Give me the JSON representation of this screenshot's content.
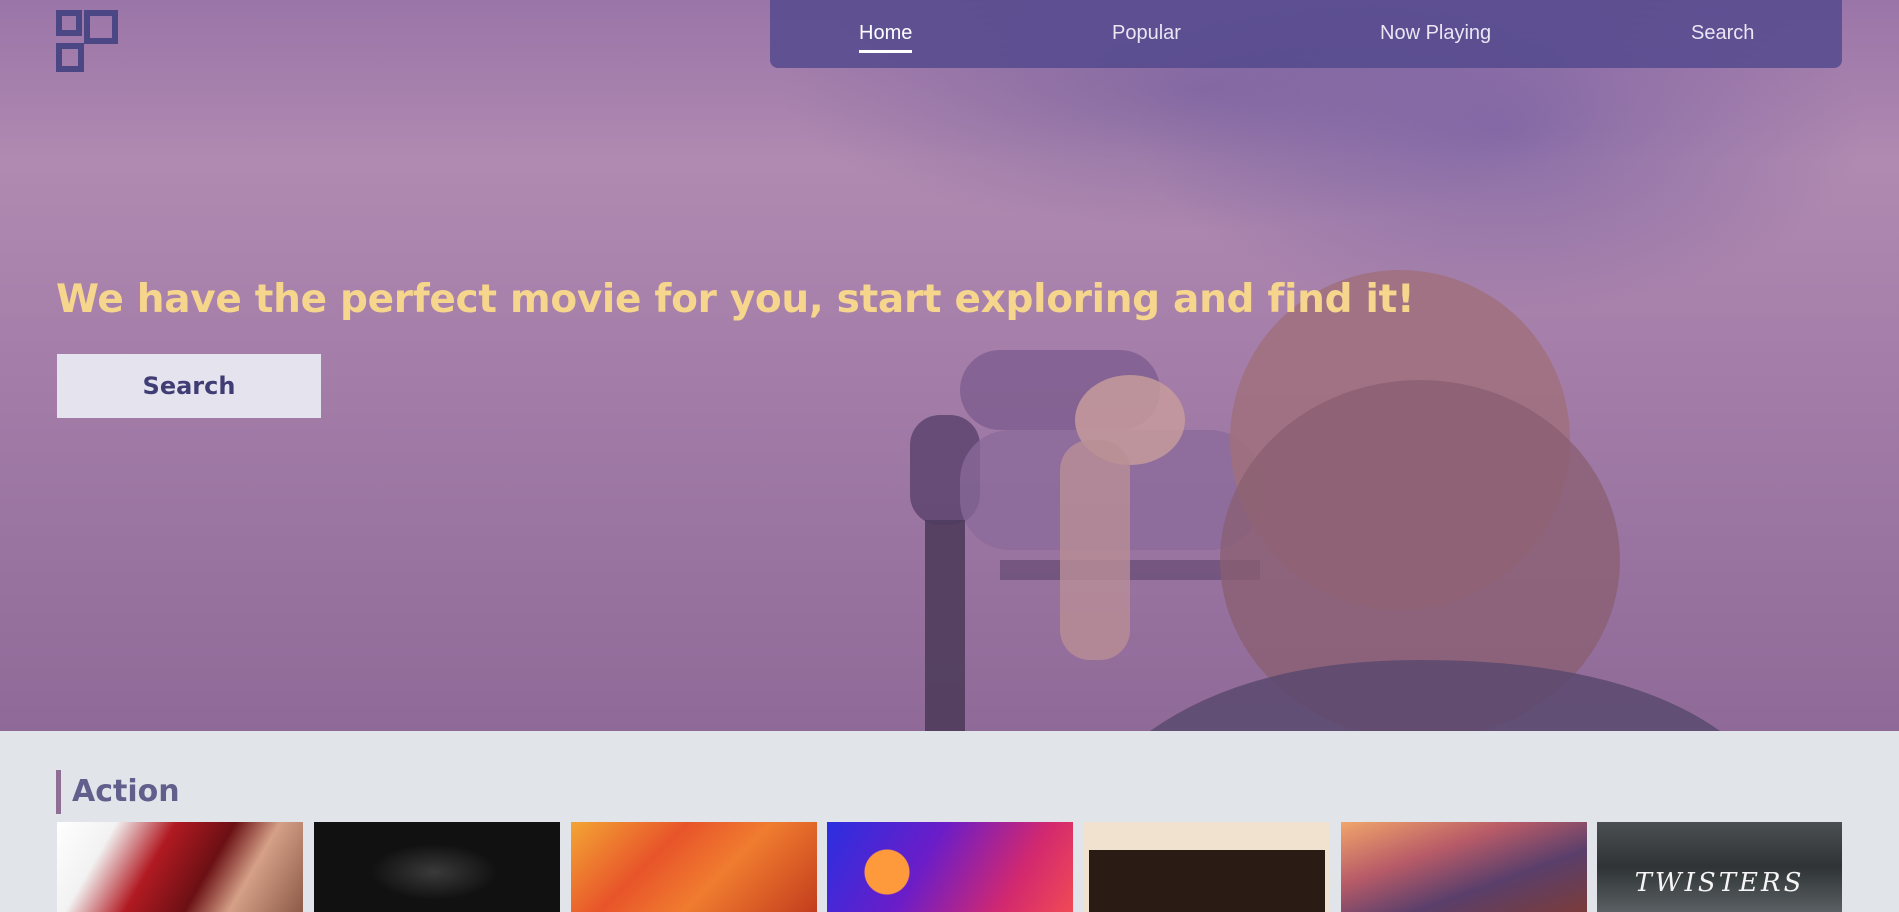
{
  "nav": {
    "items": [
      {
        "label": "Home",
        "active": true
      },
      {
        "label": "Popular",
        "active": false
      },
      {
        "label": "Now Playing",
        "active": false
      },
      {
        "label": "Search",
        "active": false
      }
    ]
  },
  "hero": {
    "headline": "We have the perfect movie for you, start exploring and find it!",
    "search_button_label": "Search"
  },
  "sections": [
    {
      "title": "Action",
      "poster_count_visible": 7,
      "posters": [
        {
          "text": ""
        },
        {
          "text": ""
        },
        {
          "text": ""
        },
        {
          "text": ""
        },
        {
          "text": ""
        },
        {
          "text": ""
        },
        {
          "text": "TWISTERS"
        }
      ]
    }
  ],
  "colors": {
    "headline": "#f6d58c",
    "nav_bg": "#52488c",
    "button_bg": "#e4e3ee",
    "button_text": "#3f3d74",
    "section_title": "#625f8c",
    "section_accent": "#8f6e95",
    "page_bg": "#e1e4e8"
  }
}
